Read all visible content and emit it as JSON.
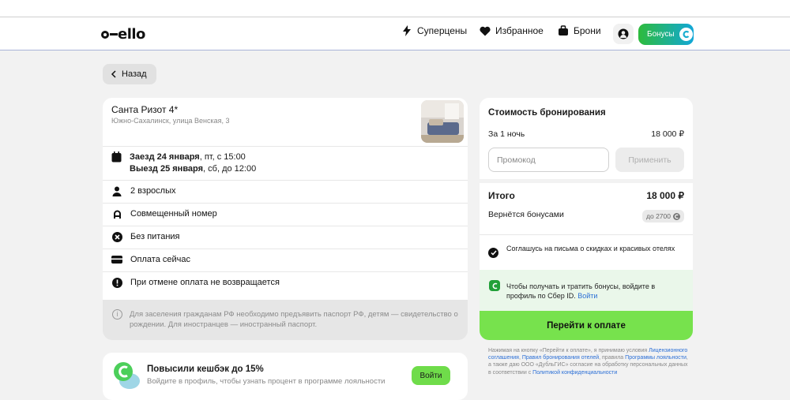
{
  "header": {
    "logo": "ello",
    "nav": {
      "super": "Суперцены",
      "favorites": "Избранное",
      "bookings": "Брони"
    },
    "bonus_button": "Бонусы"
  },
  "back_button": "Назад",
  "hotel": {
    "name": "Санта Ризот 4*",
    "address": "Южно-Сахалинск, улица Венская, 3",
    "checkin_bold": "Заезд 24 января",
    "checkin_rest": ", пт, с 15:00",
    "checkout_bold": "Выезд 25 января",
    "checkout_rest": ", сб, до 12:00",
    "guests": "2 взрослых",
    "room": "Совмещенный номер",
    "meals": "Без питания",
    "payment": "Оплата сейчас",
    "cancellation": "При отмене оплата не возвращается",
    "passport_note": "Для заселения гражданам РФ необходимо предъявить паспорт РФ, детям — свидетельство о рождении. Для иностранцев — иностранный паспорт."
  },
  "cashback": {
    "title": "Повысили кешбэк до 15%",
    "subtitle": "Войдите в профиль, чтобы узнать процент в программе лояльности",
    "button": "Войти"
  },
  "booking_cost": {
    "title": "Стоимость бронирования",
    "night_label": "За 1 ночь",
    "night_price": "18 000 ₽",
    "promo_placeholder": "Промокод",
    "apply_button": "Применить",
    "total_label": "Итого",
    "total_value": "18 000 ₽",
    "bonus_back_label": "Вернётся бонусами",
    "bonus_back_value": "до 2700",
    "agree_text": "Соглашусь на письма о скидках и красивых отелях",
    "sber_text": "Чтобы получать и тратить бонусы, войдите в профиль по Сбер ID.",
    "sber_link": "Войти",
    "pay_button": "Перейти к оплате"
  },
  "legal": {
    "t1": "Нажимая на кнопку «Перейти к оплате», я принимаю условия",
    "l1": "Лицензионного соглашения",
    "t2": ", ",
    "l2": "Правил бронирования отелей",
    "t3": ", правила",
    "l3": "Программы лояльности",
    "t4": ", а также даю ООО «ДубльГИС» согласие на обработку персональных данных в соответствии с",
    "l4": "Политикой конфиденциальности"
  },
  "colors": {
    "accent_green": "#77e24d",
    "link_blue": "#2b6fd6",
    "sber_green": "#21a038"
  }
}
